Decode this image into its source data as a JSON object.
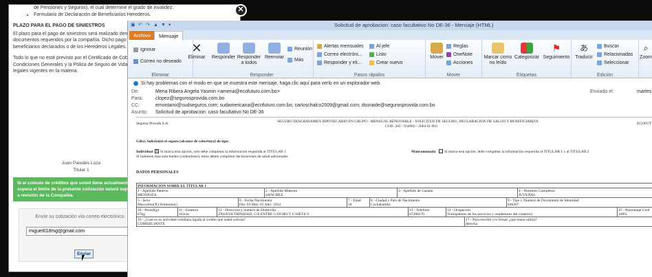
{
  "modal": {
    "intro_tail": "de Pensiones y Seguros), el cual determine el grado de invalidez.",
    "list_item": "Formulario de Declaración de Beneficiarios Herederos.",
    "heading": "PLAZO PARA EL PAGO DE SINIESTROS",
    "para1": "El plazo para el pago de siniestros será realizado dentro de los 15 días hábiles de haber recibido los documentos requeridos por la compañía. Dicho pago será mediante cheques a nombre de los beneficiarios declarados o de los Herederos Legales.",
    "para2": "Todo lo que no esté previsto por el Certificado de Cobertura se rige por las Condiciones Particulares, Condiciones Generales y la Póliza de Seguro de Vida en Grupo, el Código de Comercio y demás leyes legales vigentes en la materia.",
    "sign_name": "Juan Paredes Loza",
    "sign_role": "Titular 1",
    "green_text": "Si el cúmulo de créditos que usted tiene actualmente supera el límite de la presente cotización estará sujeta a revisión de la Compañía.",
    "email_label": "Envíe su cotización vía correo electrónico",
    "email_value": "miguel018mg@gmail.com",
    "send_button": "Enviar",
    "close_symbol": "✕"
  },
  "outlook": {
    "window_title": "Solicitud de aprobacion: caso facultativo No DE-36 - Mensaje (HTML)",
    "tabs": [
      "Archivo",
      "Mensaje"
    ],
    "ribbon": {
      "ignorar": "Ignorar",
      "correo_no_deseado": "Correo no deseado",
      "eliminar": "Eliminar",
      "group_eliminar": "Eliminar",
      "responder": "Responder",
      "responder_todos": "Responder a todos",
      "reenviar": "Reenviar",
      "reunion": "Reunión",
      "mas": "Más",
      "group_responder": "Responder",
      "alertas": "Alertas mensuales",
      "correo_elec": "Correo electróni...",
      "responder_eli": "Responder y eli...",
      "al_jefe": "Al jefe",
      "listo": "Listo",
      "crear_nuevo": "Crear nuevo",
      "group_pasos": "Pasos rápidos",
      "mover": "Mover",
      "reglas": "Reglas",
      "onenote": "OneNote",
      "acciones": "Acciones",
      "group_mover": "Mover",
      "marcar": "Marcar como no leído",
      "categorizar": "Categorizar",
      "seguimiento": "Seguimiento",
      "group_etiquetas": "Etiquetas",
      "traducir": "Traducir",
      "buscar": "Buscar",
      "relacionadas": "Relacionadas",
      "seleccionar": "Seleccionar",
      "group_edicion": "Edición",
      "zoom": "Zoom"
    },
    "info_bar": "Si hay problemas con el modo en que se muestra este mensaje, haga clic aquí para verlo en un explorador web.",
    "headers": {
      "de_label": "De:",
      "de": "Mena Ribera Angela Yasmin <amena@ecofuturo.com.bo>",
      "para_label": "Para:",
      "para": "clopez@segurosprovida.com.bo",
      "cc_label": "CC:",
      "cc": "emontano@sudseguros.com; sudamericana@ecofuturo.com.bo; carloschalco2009@gmail.com; dsoraide@segurosprovida.com.bo",
      "asunto_label": "Asunto:",
      "asunto": "Solicitud de aprobacion: caso facultativo No DE-36",
      "enviado_label": "Enviado el:",
      "enviado": "martes"
    },
    "doc": {
      "company": "Seguros Provida S.A.",
      "form_title": "SEGURO DESGRAVAMEN HIPOTECARIO EN GRUPO - MENSUAL RENOVABLE - SOLICITUD DE SEGURO, DECLARACION DE SALUD Y BENEFICIARIOS",
      "cod": "COD. 205 - 934903 - 2004 01 003",
      "ecofu": "ECOFUT",
      "question": "Ud(s). Solicita(n) el seguro (alcance de cobertura) de tipo:",
      "individual": "Individual",
      "individual_text": "Si marca esta opción, solo debe completar la información requerida al TITULAR 1",
      "multi_text": "Si hubiesen más solicitantes (codeudores), estos deben completar declaraciones de salud adicionales",
      "mancomunada": "Mancomunada",
      "mancomunada_text": "Si marca esta opción, debe completar la información requerida al TITULAR 1 y al TITULAR 2",
      "datos": "DATOS PERSONALES",
      "info_titular": "INFORMACION SOBRE EL TITULAR 1",
      "c1l": "1 - Apellido Paterno",
      "c1v": "MENDOZA",
      "c2l": "2 - Apellido Materno",
      "c2v": "SANCHEZ",
      "c3l": "3 - Apellido de Casada",
      "c3v": "",
      "c4l": "4 - Nombres Completos",
      "c4v": "JUVENAL",
      "c5l": "5 - Sexo",
      "c5v": "Masculino(X) Femenino()",
      "c6l": "6 - Fecha Nacimiento",
      "c6v": "Dia: 03 Mes: 05 Año: 1954",
      "c7l": "7 - Edad",
      "c7v": "58",
      "c8l": "8 - Ciudad y País de Nacimiento",
      "c8v": "Cochabamba",
      "c9l": "9 - Tipo y Numero de Documento de Identidad",
      "c9v": "846207",
      "c10l": "10 - Peso(Kg)",
      "c10v": "67kg",
      "c11l": "11 - Estatura",
      "c11v": "162cm",
      "c12l": "12 - Direccion y numero de Domicilio",
      "c12v": "ZNUEVA TRINIDAD, C/8 ENTRE C/OCHO Y C/SIETE 0",
      "c13l": "13 - Telefono",
      "c13v": "67288270",
      "c14l": "14 - Ocupación",
      "c14v": "Trabajadores de los servicios y vendedores del comercio",
      "c15l": "15 - Porcentaje Cred",
      "c15v": "100%",
      "c16l": "16 - ¿Cual es su actividad cotidiana ligada al credito que usted solicita?",
      "c16v": "COMERCIANTE",
      "c17l": "17 - Para escribir y/o firmar ¿que mano utiliza?",
      "c17v": "derecha"
    }
  }
}
